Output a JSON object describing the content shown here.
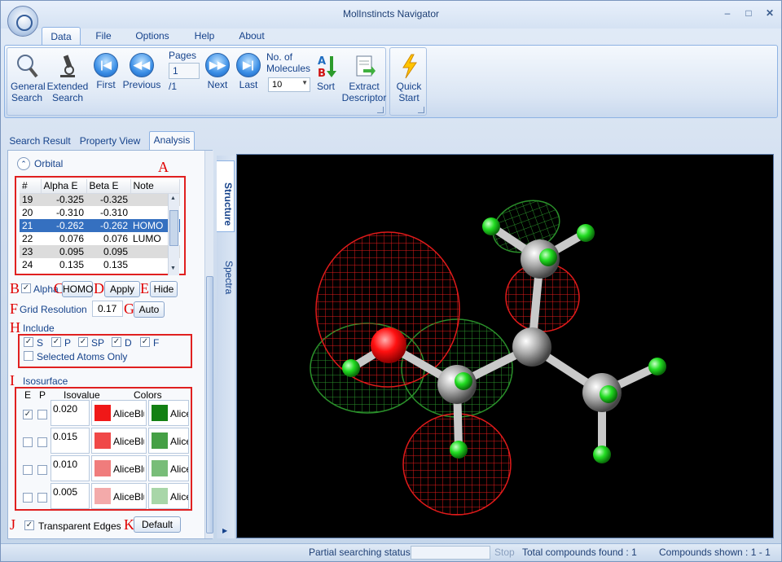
{
  "window": {
    "title": "MolInstincts Navigator"
  },
  "ribbon_tabs": [
    "Data",
    "File",
    "Options",
    "Help",
    "About"
  ],
  "ribbon": {
    "general_search": [
      "General",
      "Search"
    ],
    "extended_search": [
      "Extended",
      "Search"
    ],
    "first": "First",
    "previous": "Previous",
    "pages_label": "Pages",
    "page_value": "1",
    "page_total": "/1",
    "next": "Next",
    "last": "Last",
    "no_of_molecules": [
      "No. of",
      "Molecules"
    ],
    "molecules_value": "10",
    "sort": "Sort",
    "extract_descriptor": [
      "Extract",
      "Descriptor"
    ],
    "quick_start": [
      "Quick",
      "Start"
    ]
  },
  "content_tabs": [
    "Search Result",
    "Property View",
    "Analysis"
  ],
  "side_tabs": [
    "Structure",
    "Spectra"
  ],
  "orbital": {
    "section_title": "Orbital",
    "columns": [
      "#",
      "Alpha E",
      "Beta E",
      "Note"
    ],
    "rows": [
      {
        "n": "19",
        "a": "-0.325",
        "b": "-0.325",
        "note": ""
      },
      {
        "n": "20",
        "a": "-0.310",
        "b": "-0.310",
        "note": ""
      },
      {
        "n": "21",
        "a": "-0.262",
        "b": "-0.262",
        "note": "HOMO"
      },
      {
        "n": "22",
        "a": "0.076",
        "b": "0.076",
        "note": "LUMO"
      },
      {
        "n": "23",
        "a": "0.095",
        "b": "0.095",
        "note": ""
      },
      {
        "n": "24",
        "a": "0.135",
        "b": "0.135",
        "note": ""
      }
    ]
  },
  "controls": {
    "alpha": "Alpha",
    "homo": "HOMO",
    "apply": "Apply",
    "hide": "Hide",
    "grid_resolution": "Grid Resolution",
    "grid_value": "0.17",
    "auto": "Auto",
    "include": "Include",
    "include_items": [
      "S",
      "P",
      "SP",
      "D",
      "F"
    ],
    "selected_atoms_only": "Selected Atoms Only",
    "isosurface": "Isosurface",
    "iso_cols": [
      "E",
      "P",
      "Isovalue",
      "Colors"
    ],
    "iso_rows": [
      {
        "value": "0.020",
        "c1": "AliceBlu",
        "c2": "Alice",
        "col1": "#f01818",
        "col2": "#138013"
      },
      {
        "value": "0.015",
        "c1": "AliceBlu",
        "c2": "Alice",
        "col1": "#f04848",
        "col2": "#45a045"
      },
      {
        "value": "0.010",
        "c1": "AliceBlu",
        "c2": "Alice",
        "col1": "#f07c7c",
        "col2": "#78bd78"
      },
      {
        "value": "0.005",
        "c1": "AliceBlu",
        "c2": "Alice",
        "col1": "#f3aaaa",
        "col2": "#a8d6a8"
      }
    ],
    "transparent_edges": "Transparent Edges",
    "default": "Default"
  },
  "annotation_letters": [
    "A",
    "B",
    "C",
    "D",
    "E",
    "F",
    "G",
    "H",
    "I",
    "J",
    "K"
  ],
  "status": {
    "partial_label": "Partial searching status :",
    "stop": "Stop",
    "total": "Total compounds found : 1",
    "shown": "Compounds shown : 1 - 1"
  },
  "colors": {
    "accent": "#15428b",
    "annotation": "#e00000",
    "selected_row": "#3570c0"
  }
}
